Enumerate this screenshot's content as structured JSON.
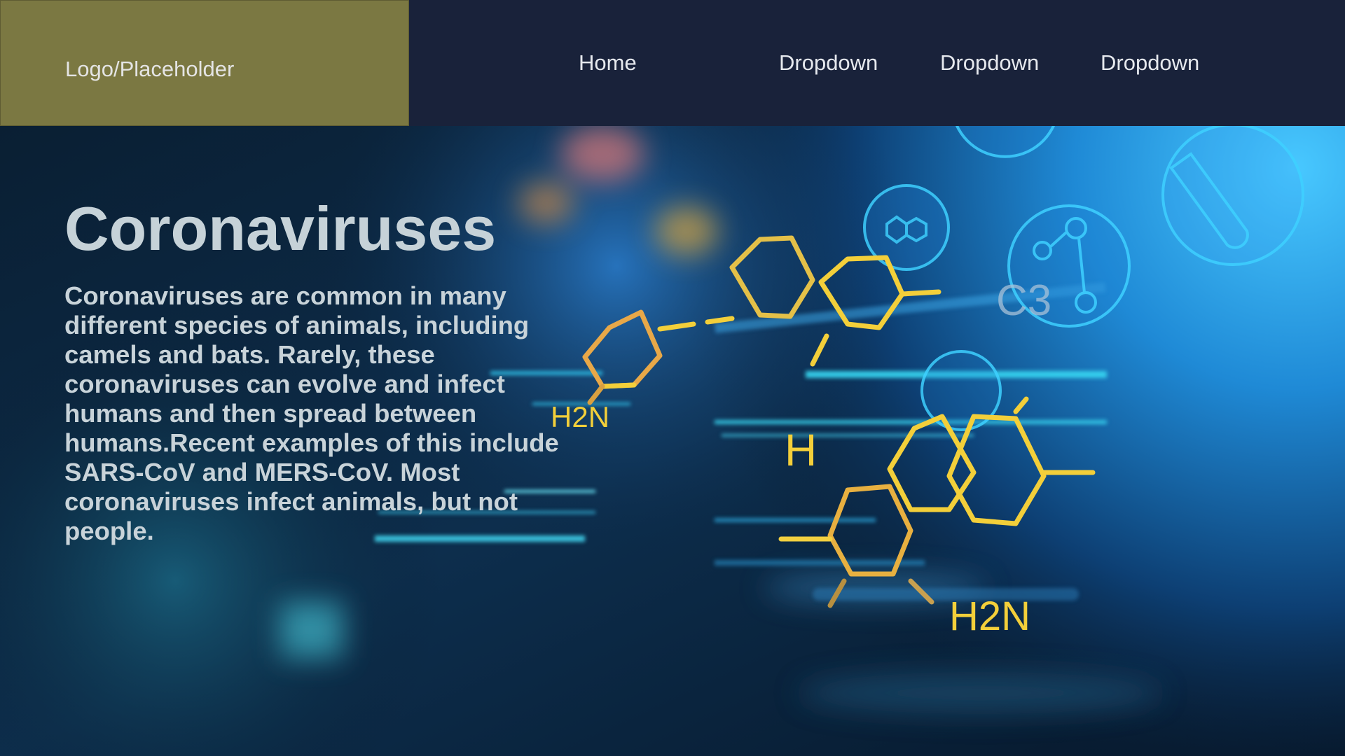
{
  "header": {
    "logo_text": "Logo/Placeholder",
    "nav": [
      {
        "label": "Home"
      },
      {
        "label": "Dropdown"
      },
      {
        "label": "Dropdown"
      },
      {
        "label": "Dropdown"
      }
    ]
  },
  "hero": {
    "title": "Coronaviruses",
    "body": "Coronaviruses are common in many different species of animals, including camels and bats. Rarely, these coronaviruses can evolve and infect humans and then spread between humans.Recent examples of this include SARS-CoV and MERS-CoV. Most coronaviruses infect animals, but not people.",
    "image": {
      "labels": [
        "H2N",
        "H",
        "H2N",
        "C3"
      ]
    }
  },
  "colors": {
    "header_bg": "#19223a",
    "logo_bg": "#7b7842",
    "molecule_yellow": "#f3cf3a",
    "accent_cyan": "#2fc6ee"
  }
}
